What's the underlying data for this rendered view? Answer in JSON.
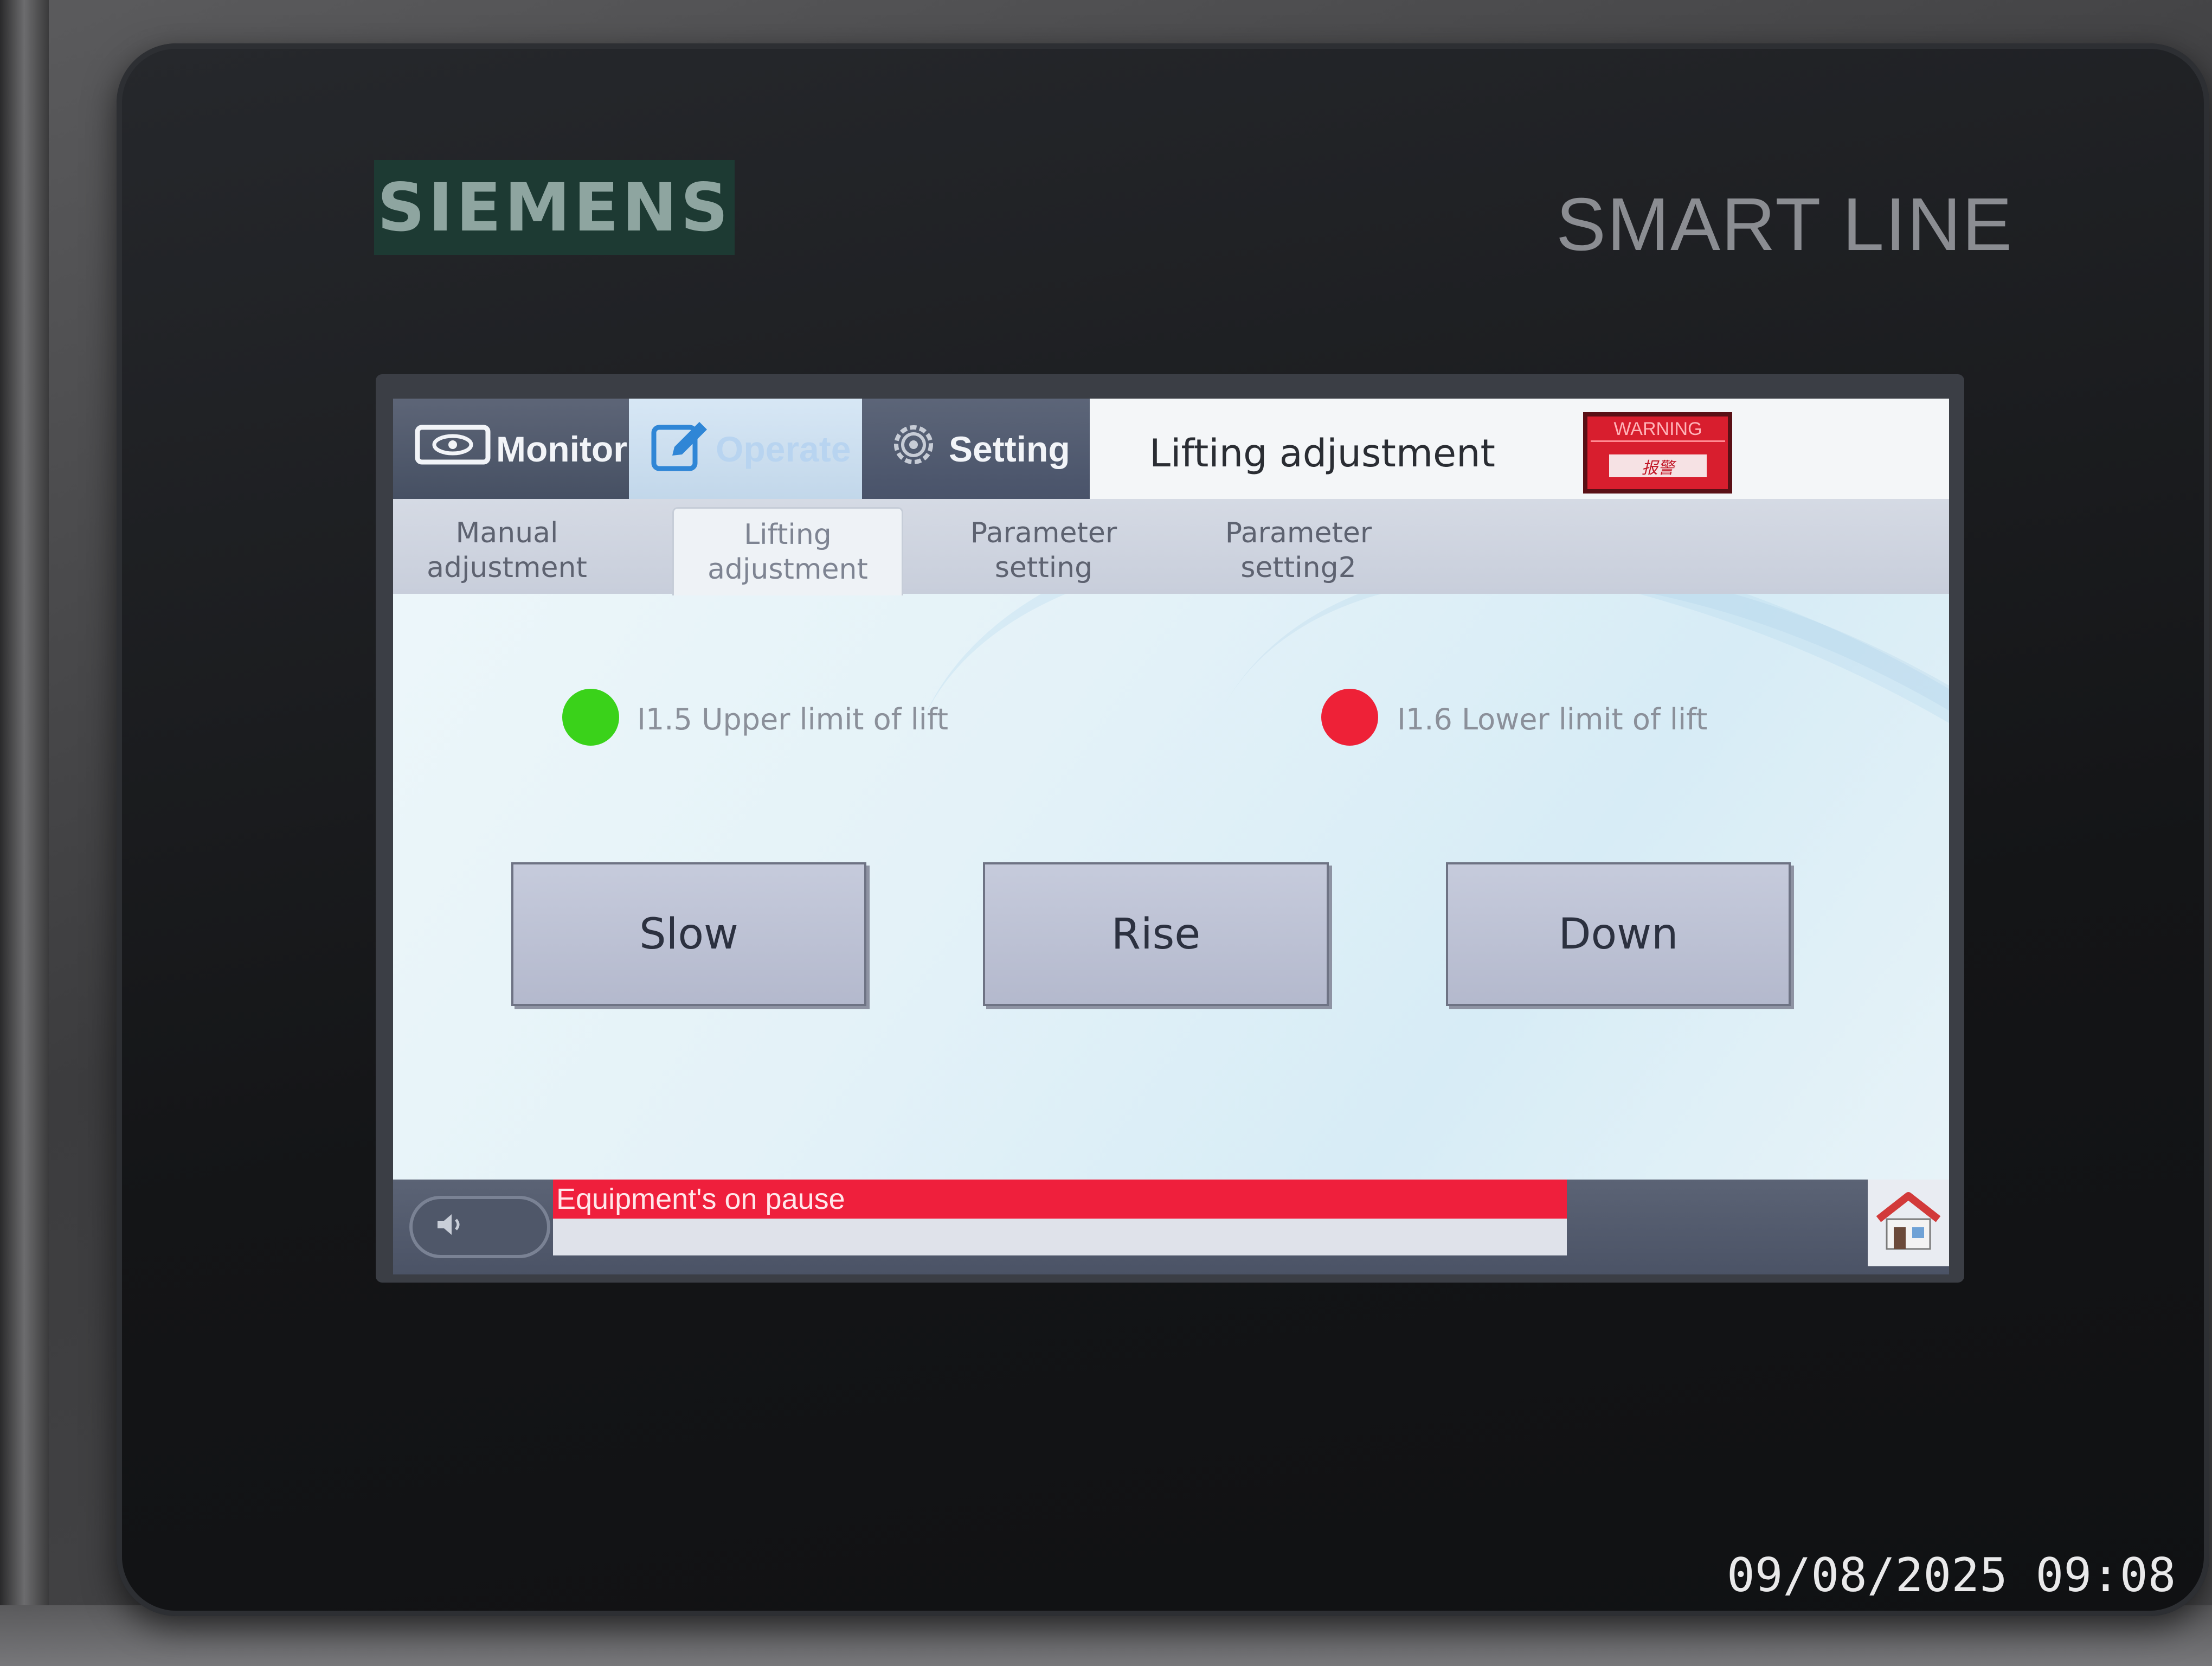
{
  "device": {
    "brand": "SIEMENS",
    "model": "SMART LINE"
  },
  "menu": {
    "tabs": [
      {
        "label": "Monitor",
        "icon": "monitor-icon"
      },
      {
        "label": "Operate",
        "icon": "edit-icon"
      },
      {
        "label": "Setting",
        "icon": "gear-icon"
      }
    ],
    "active_tab": "Operate"
  },
  "page_title": "Lifting adjustment",
  "warning_badge": {
    "label": "WARNING",
    "sublabel": "报警",
    "color": "#d81e2e"
  },
  "sub_tabs": [
    {
      "line1": "Manual",
      "line2": "adjustment"
    },
    {
      "line1": "Lifting",
      "line2": "adjustment"
    },
    {
      "line1": "Parameter",
      "line2": "setting"
    },
    {
      "line1": "Parameter",
      "line2": "setting2"
    }
  ],
  "active_sub_tab": "Lifting adjustment",
  "indicators": {
    "upper": {
      "label": "I1.5  Upper limit of lift",
      "state": "on",
      "color": "#3ad21a"
    },
    "lower": {
      "label": "I1.6  Lower  limit of lift",
      "state": "on",
      "color": "#ee2137"
    }
  },
  "buttons": {
    "slow": "Slow",
    "rise": "Rise",
    "down": "Down"
  },
  "status_bar": {
    "alarm_message": "Equipment's on pause",
    "alarm_color": "#ef1f3c",
    "speaker_icon": "speaker-icon",
    "home_icon": "home-icon"
  },
  "photo_timestamp": "09/08/2025 09:08"
}
